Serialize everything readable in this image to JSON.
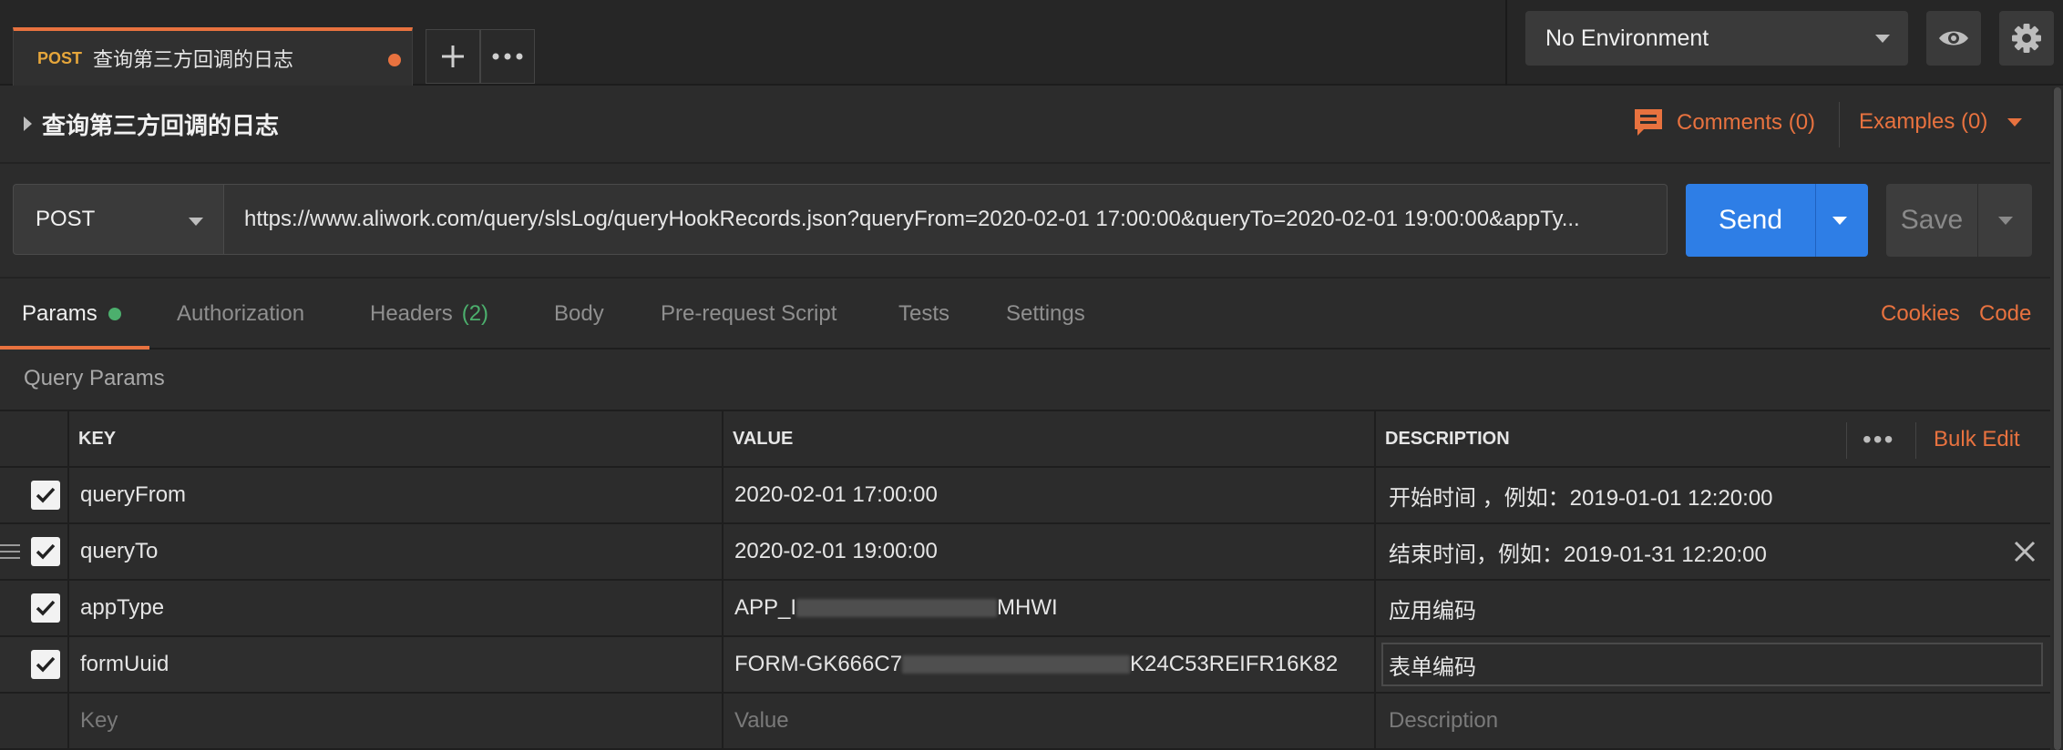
{
  "colors": {
    "accent": "#e8723f",
    "send": "#2e7ee6",
    "green": "#4caf6d",
    "method_tab": "#e6a63b"
  },
  "tab": {
    "method": "POST",
    "title": "查询第三方回调的日志",
    "new_tab_icon": "plus-icon",
    "more_icon": "ellipsis-icon"
  },
  "environment": {
    "selected": "No Environment",
    "eye_icon": "eye-icon",
    "settings_icon": "gear-icon"
  },
  "request": {
    "name": "查询第三方回调的日志",
    "comments_label": "Comments (0)",
    "examples_label": "Examples (0)",
    "method": "POST",
    "url": "https://www.aliwork.com/query/slsLog/queryHookRecords.json?queryFrom=2020-02-01 17:00:00&queryTo=2020-02-01 19:00:00&appTy...",
    "send_label": "Send",
    "save_label": "Save"
  },
  "subtabs": {
    "params": "Params",
    "authorization": "Authorization",
    "headers": "Headers",
    "headers_count": "(2)",
    "body": "Body",
    "prerequest": "Pre-request Script",
    "tests": "Tests",
    "settings": "Settings",
    "cookies": "Cookies",
    "code": "Code"
  },
  "params": {
    "section_title": "Query Params",
    "headers": {
      "key": "KEY",
      "value": "VALUE",
      "description": "DESCRIPTION",
      "bulk_edit": "Bulk Edit",
      "more": "•••"
    },
    "rows": [
      {
        "key": "queryFrom",
        "value": "2020-02-01 17:00:00",
        "description": "开始时间 ，例如：2019-01-01 12:20:00",
        "checked": true
      },
      {
        "key": "queryTo",
        "value": "2020-02-01 19:00:00",
        "description": "结束时间，例如：2019-01-31 12:20:00",
        "checked": true
      },
      {
        "key": "appType",
        "value_prefix": "APP_I",
        "value_suffix": "MHWI",
        "description": "应用编码",
        "checked": true
      },
      {
        "key": "formUuid",
        "value_prefix": "FORM-GK666C7",
        "value_suffix": "K24C53REIFR16K82",
        "description": "表单编码",
        "checked": true
      }
    ],
    "placeholder": {
      "key": "Key",
      "value": "Value",
      "description": "Description"
    }
  }
}
